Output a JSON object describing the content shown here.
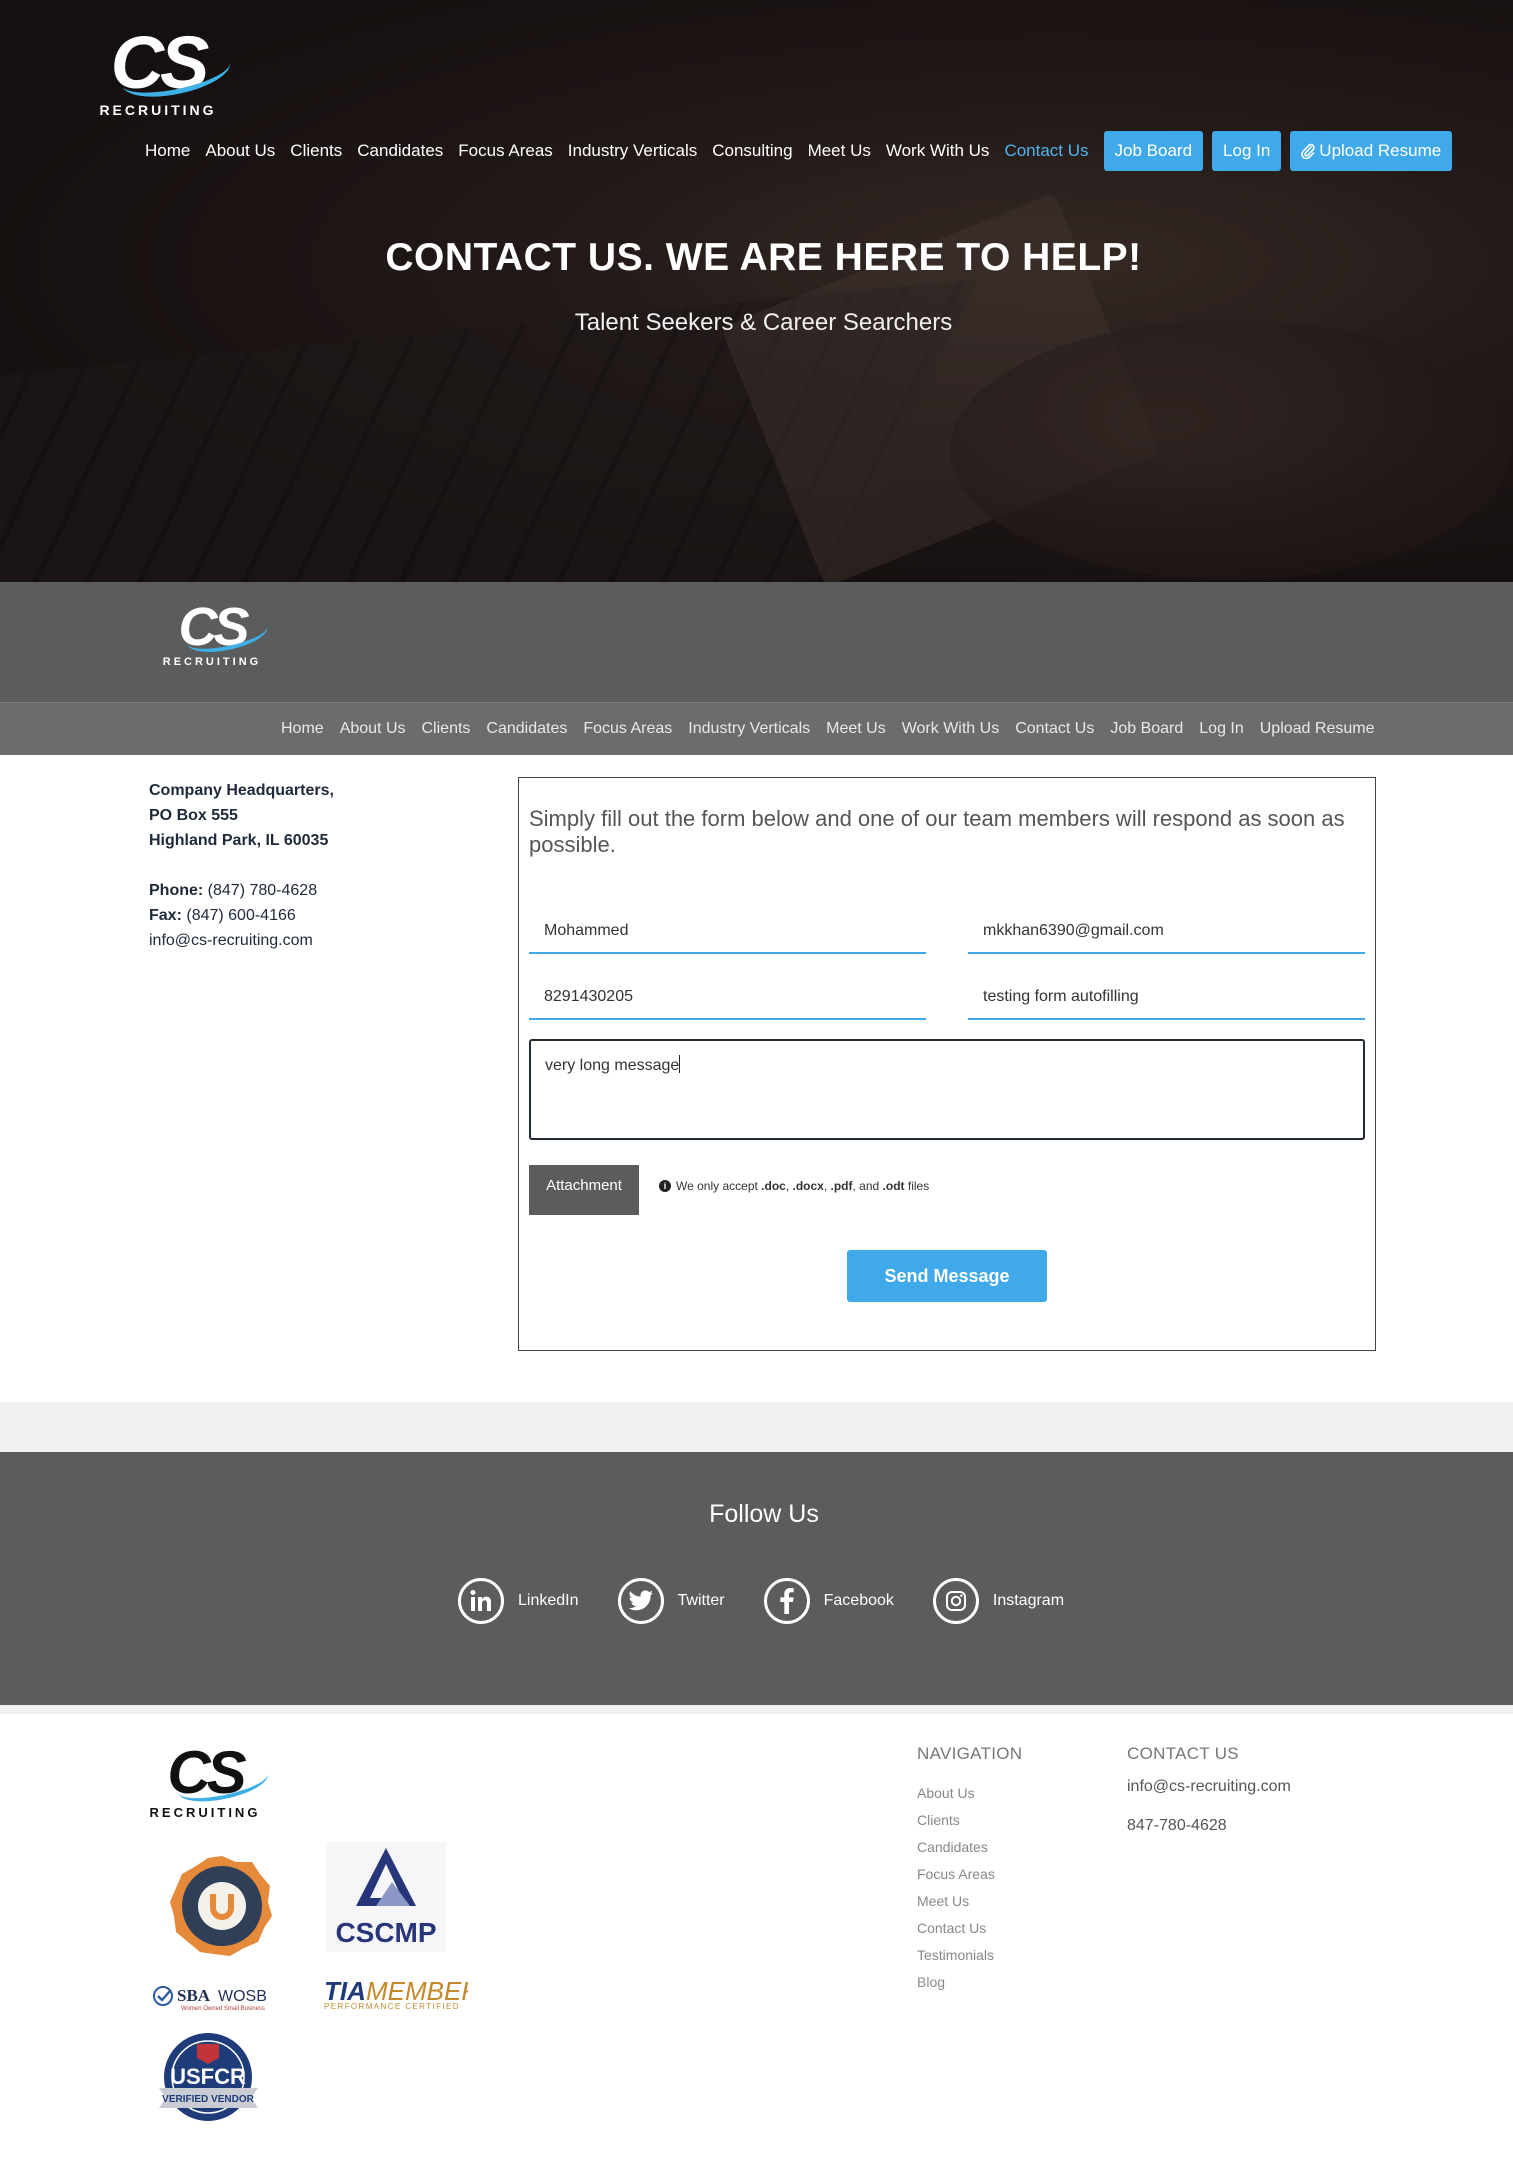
{
  "brand": {
    "mark": "CS",
    "sub": "RECRUITING",
    "accent": "#3fa9e9"
  },
  "hero_nav": {
    "links": [
      "Home",
      "About Us",
      "Clients",
      "Candidates",
      "Focus Areas",
      "Industry Verticals",
      "Consulting",
      "Meet Us",
      "Work With Us",
      "Contact Us"
    ],
    "active": "Contact Us",
    "buttons": [
      "Job Board",
      "Log In",
      "Upload Resume"
    ]
  },
  "hero": {
    "title": "CONTACT US. WE ARE HERE TO HELP!",
    "subtitle": "Talent Seekers & Career Searchers"
  },
  "sticky_nav": {
    "links": [
      "Home",
      "About Us",
      "Clients",
      "Candidates",
      "Focus Areas",
      "Industry Verticals",
      "Meet Us",
      "Work With Us",
      "Contact Us",
      "Job Board",
      "Log In",
      "Upload Resume"
    ]
  },
  "headquarters": {
    "line1": "Company Headquarters,",
    "line2": "PO Box 555",
    "line3": "Highland Park, IL 60035",
    "phone_label": "Phone:",
    "phone": "(847) 780-4628",
    "fax_label": "Fax:",
    "fax": "(847) 600-4166",
    "email": "info@cs-recruiting.com"
  },
  "form": {
    "intro": "Simply fill out the form below and one of our team members will respond as soon as possible.",
    "name": "Mohammed",
    "email": "mkkhan6390@gmail.com",
    "phone": "8291430205",
    "subject": "testing form autofilling",
    "message": "very long message",
    "attachment_label": "Attachment",
    "accept_prefix": "We only accept ",
    "accept_doc": ".doc",
    "accept_docx": ".docx",
    "accept_pdf": ".pdf",
    "accept_odt": ".odt",
    "accept_sep1": ", ",
    "accept_sep2": ", ",
    "accept_sep3": ", and ",
    "accept_suffix": " files",
    "send_label": "Send Message"
  },
  "follow": {
    "title": "Follow Us",
    "items": [
      {
        "label": "LinkedIn",
        "icon": "linkedin-icon"
      },
      {
        "label": "Twitter",
        "icon": "twitter-icon"
      },
      {
        "label": "Facebook",
        "icon": "facebook-icon"
      },
      {
        "label": "Instagram",
        "icon": "instagram-icon"
      }
    ]
  },
  "footer": {
    "badges": {
      "cscmp": "CSCMP",
      "sba": "SBA",
      "wosb": "WOSB",
      "sba_caption": "Women Owned Small Business",
      "tia": "TIA",
      "tia_member": "MEMBER",
      "tia_caption": "PERFORMANCE CERTIFIED",
      "usfcr": "USFCR",
      "usfcr_caption": "VERIFIED VENDOR"
    },
    "nav_title": "NAVIGATION",
    "nav_links": [
      "About Us",
      "Clients",
      "Candidates",
      "Focus Areas",
      "Meet Us",
      "Contact Us",
      "Testimonials",
      "Blog"
    ],
    "contact_title": "CONTACT US",
    "contact_email": "info@cs-recruiting.com",
    "contact_phone": "847-780-4628"
  }
}
